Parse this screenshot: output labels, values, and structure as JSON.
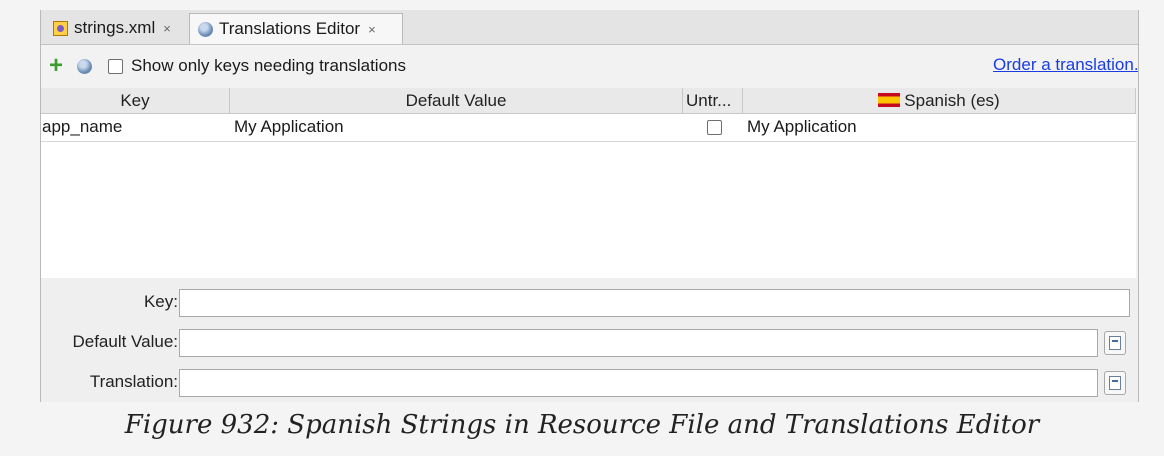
{
  "tabs": [
    {
      "label": "strings.xml",
      "close": "×",
      "icon": "xml-file-icon"
    },
    {
      "label": "Translations Editor",
      "close": "×",
      "icon": "globe-icon"
    }
  ],
  "toolbar": {
    "add_icon": "+",
    "checkbox_label": "Show only keys needing translations",
    "order_link": "Order a translation..."
  },
  "table": {
    "headers": [
      "Key",
      "Default Value",
      "Untr...",
      "Spanish (es)"
    ],
    "rows": [
      {
        "key": "app_name",
        "default_value": "My Application",
        "untranslatable": false,
        "spanish": "My Application"
      }
    ]
  },
  "form": {
    "key_label": "Key:",
    "default_label": "Default Value:",
    "translation_label": "Translation:",
    "key_value": "",
    "default_value": "",
    "translation_value": ""
  },
  "caption": "Figure 932: Spanish Strings in Resource File and Translations Editor",
  "colors": {
    "link": "#1a3de0",
    "add_icon": "#3a9d2e"
  }
}
